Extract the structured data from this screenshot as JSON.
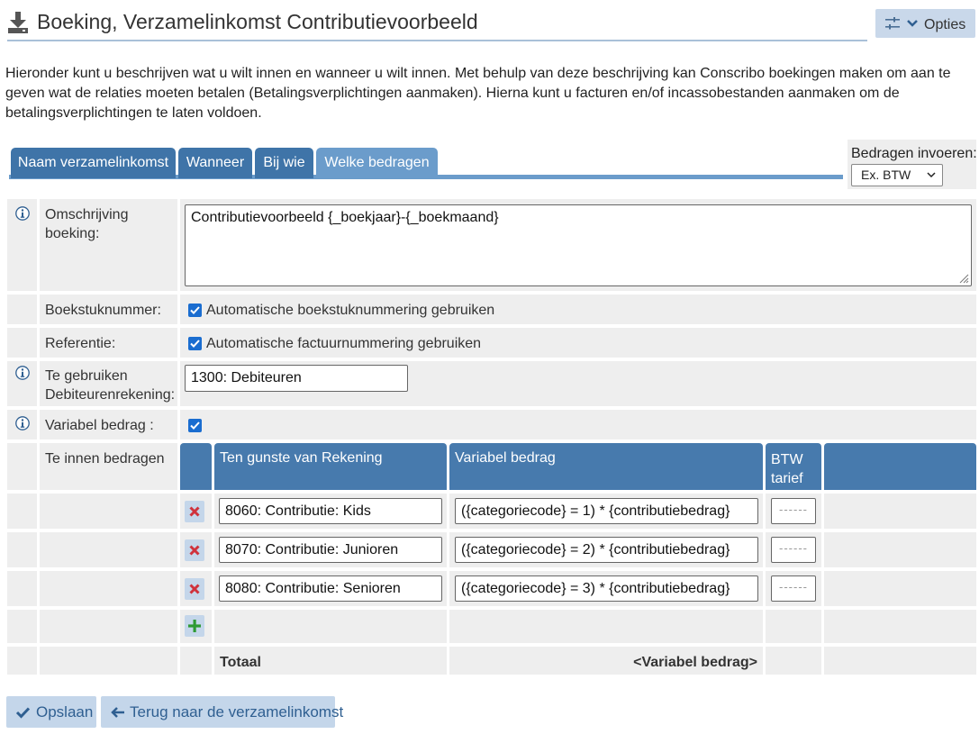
{
  "header": {
    "title": "Boeking, Verzamelinkomst Contributievoorbeeld",
    "options_label": "Opties"
  },
  "intro": "Hieronder kunt u beschrijven wat u wilt innen en wanneer u wilt innen. Met behulp van deze beschrijving kan Conscribo boekingen maken om aan te geven wat de relaties moeten betalen (Betalingsverplichtingen aanmaken). Hierna kunt u facturen en/of incassobestanden aanmaken om de betalingsverplichtingen te laten voldoen.",
  "tabs": [
    {
      "label": "Naam verzamelinkomst",
      "active": false
    },
    {
      "label": "Wanneer",
      "active": false
    },
    {
      "label": "Bij wie",
      "active": false
    },
    {
      "label": "Welke bedragen",
      "active": true
    }
  ],
  "amount_entry": {
    "label": "Bedragen invoeren:",
    "selected": "Ex. BTW"
  },
  "form": {
    "description_label": "Omschrijving boeking:",
    "description_value": "Contributievoorbeeld {_boekjaar}-{_boekmaand}",
    "document_number_label": "Boekstuknummer:",
    "document_number_checkbox": "Automatische boekstuknummering gebruiken",
    "document_number_checked": true,
    "reference_label": "Referentie:",
    "reference_checkbox": "Automatische factuurnummering gebruiken",
    "reference_checked": true,
    "debtor_account_label": "Te gebruiken Debiteurenrekening:",
    "debtor_account_value": "1300: Debiteuren",
    "variable_amount_label": "Variabel bedrag :",
    "variable_amount_checked": true,
    "amounts_label": "Te innen bedragen"
  },
  "amounts_table": {
    "columns": [
      "Ten gunste van Rekening",
      "Variabel bedrag",
      "BTW tarief"
    ],
    "rows": [
      {
        "account": "8060: Contributie: Kids",
        "formula": "({categoriecode} = 1) * {contributiebedrag}",
        "vat": "------"
      },
      {
        "account": "8070: Contributie: Junioren",
        "formula": "({categoriecode} = 2) * {contributiebedrag}",
        "vat": "------"
      },
      {
        "account": "8080: Contributie: Senioren",
        "formula": "({categoriecode} = 3) * {contributiebedrag}",
        "vat": "------"
      }
    ],
    "total_label": "Totaal",
    "total_value": "<Variabel bedrag>"
  },
  "footer": {
    "save_label": "Opslaan",
    "back_label": "Terug naar de verzamelinkomst"
  },
  "colors": {
    "tab": "#3f74a8",
    "tab_active": "#6b9ccb",
    "table_header": "#477aad",
    "button_bg": "#c4d6ea",
    "button_text": "#2f5f91",
    "delete_icon": "#d0323c",
    "add_icon": "#2e9a34",
    "checkbox": "#1a6dd0",
    "info_icon": "#2f5f91"
  },
  "icons": [
    "download-icon",
    "sliders-icon",
    "chevron-down-icon",
    "info-icon",
    "checkmark-icon",
    "delete-icon",
    "add-icon",
    "arrow-left-icon"
  ]
}
